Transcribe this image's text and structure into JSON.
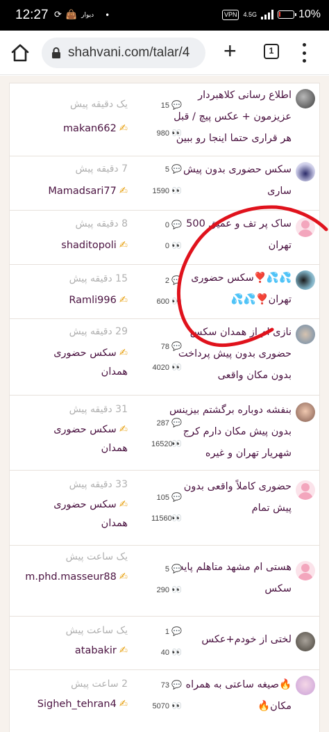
{
  "status_bar": {
    "time": "12:27",
    "app_label": "دیوار",
    "vpn": "VPN",
    "network": "4.5G",
    "battery": "10%",
    "battery_level": 0.1
  },
  "browser": {
    "url": "shahvani.com/talar/4",
    "tab_count": "1",
    "icons": [
      "home-icon",
      "lock-icon",
      "new-tab-icon",
      "tab-switcher-icon",
      "menu-icon"
    ]
  },
  "threads": [
    {
      "title": "اطلاع رسانی کلاهبردار عزیزمون + عکس پیچ / قبل هر قراری حتما اینجا رو ببین",
      "replies": "15",
      "views": "980",
      "time": "یک دقیقه پیش",
      "author": "makan662"
    },
    {
      "title": "سکس حضوری بدون پیش ساری",
      "replies": "5",
      "views": "1590",
      "time": "7 دقیقه پیش",
      "author": "Mamadsari77"
    },
    {
      "title": "ساک پر تف و عمیق 500 تهران",
      "replies": "0",
      "views": "0",
      "time": "8 دقیقه پیش",
      "author": "shaditopoli"
    },
    {
      "title": "💦💦❣️سکس حضوری تهران❣️💦💦",
      "replies": "2",
      "views": "600",
      "time": "15 دقیقه پیش",
      "author": "Ramli996"
    },
    {
      "title": "نازی ام از همدان سکس حضوری بدون پیش پرداخت بدون مکان واقعی",
      "replies": "78",
      "views": "4020",
      "time": "29 دقیقه پیش",
      "author": "سکس حضوری همدان"
    },
    {
      "title": "بنفشه دوباره برگشتم بیزینس بدون پیش مکان دارم کرج شهریار تهران و غیره",
      "replies": "287",
      "views": "16520",
      "time": "31 دقیقه پیش",
      "author": "سکس حضوری همدان"
    },
    {
      "title": "حضوری کاملاً واقعی بدون پیش تمام",
      "replies": "105",
      "views": "11560",
      "time": "33 دقیقه پیش",
      "author": "سکس حضوری همدان"
    },
    {
      "title": "هستی ام مشهد متاهلم پایه سکس",
      "replies": "5",
      "views": "290",
      "time": "یک ساعت پیش",
      "author": "m.phd.masseur88"
    },
    {
      "title": "لختی از خودم+عکس",
      "replies": "1",
      "views": "40",
      "time": "یک ساعت پیش",
      "author": "atabakir"
    },
    {
      "title": "🔥صیغه ساعتی به همراه مکان🔥",
      "replies": "73",
      "views": "5070",
      "time": "2 ساعت پیش",
      "author": "Sigheh_tehran4"
    }
  ],
  "colors": {
    "title_text": "#4a1240",
    "time_text": "#b0b0b0",
    "page_bg": "#f7f2ed",
    "annotation": "#e0121c"
  }
}
